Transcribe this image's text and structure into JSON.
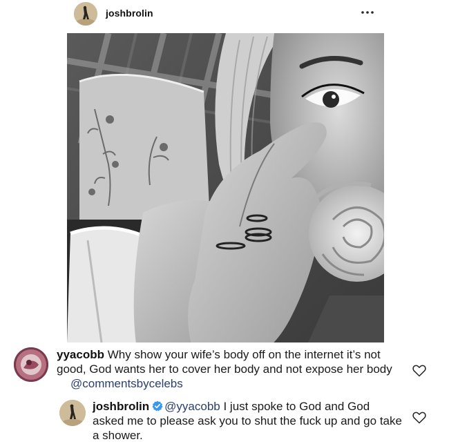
{
  "post": {
    "author": {
      "username": "joshbrolin",
      "avatar_icon": "profile-photo"
    },
    "more_icon": "more-horizontal-icon",
    "photo": {
      "style": "black-and-white selfie",
      "subject": "woman holding a rose near her face, lying on a pillow"
    }
  },
  "comments": [
    {
      "username": "yyacobb",
      "text": "Why show your wife’s body off on the internet it’s not good, God wants her to cover her body and not expose her body",
      "tag": "@commentsbycelebs",
      "like_icon": "heart-outline-icon"
    },
    {
      "username": "joshbrolin",
      "verified": true,
      "mention": "@yyacobb",
      "text": "I just spoke to God and God asked me to please ask you to shut the fuck up and go take a shower.",
      "like_icon": "heart-outline-icon"
    }
  ],
  "colors": {
    "verified_badge": "#3897f0",
    "mention": "#2a3f6b",
    "text": "#111111",
    "icon": "#262626"
  }
}
